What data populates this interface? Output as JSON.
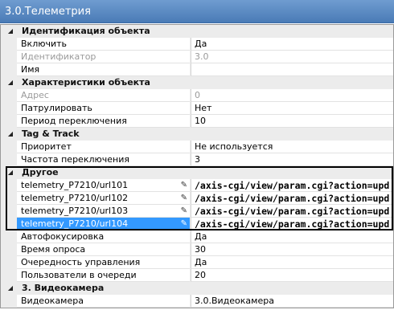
{
  "window": {
    "title": "3.0.Телеметрия"
  },
  "toggle_glyph": "◢",
  "pencil_glyph": "✎",
  "categories": [
    {
      "label": "Идентификация объекта",
      "props": [
        {
          "name": "Включить",
          "value": "Да"
        },
        {
          "name": "Идентификатор",
          "value": "3.0"
        },
        {
          "name": "Имя",
          "value": ""
        }
      ]
    },
    {
      "label": "Характеристики объекта",
      "props": [
        {
          "name": "Адрес",
          "value": "0"
        },
        {
          "name": "Патрулировать",
          "value": "Нет"
        },
        {
          "name": "Период переключения",
          "value": "10"
        }
      ]
    },
    {
      "label": "Tag & Track",
      "props": [
        {
          "name": "Приоритет",
          "value": "Не используется"
        },
        {
          "name": "Частота переключения",
          "value": "3"
        }
      ]
    },
    {
      "label": "Другое",
      "props": [
        {
          "name": "telemetry_P7210/url101",
          "value": "/axis-cgi/view/param.cgi?action=upd"
        },
        {
          "name": "telemetry_P7210/url102",
          "value": "/axis-cgi/view/param.cgi?action=upd"
        },
        {
          "name": "telemetry_P7210/url103",
          "value": "/axis-cgi/view/param.cgi?action=upd"
        },
        {
          "name": "telemetry_P7210/url104",
          "value": "/axis-cgi/view/param.cgi?action=upd"
        },
        {
          "name": "Автофокусировка",
          "value": "Да"
        },
        {
          "name": "Время опроса",
          "value": "30"
        },
        {
          "name": "Очередность управления",
          "value": "Да"
        },
        {
          "name": "Пользователи в очереди",
          "value": "20"
        }
      ]
    },
    {
      "label": "3. Видеокамера",
      "props": [
        {
          "name": "Видеокамера",
          "value": "3.0.Видеокамера"
        }
      ]
    }
  ]
}
